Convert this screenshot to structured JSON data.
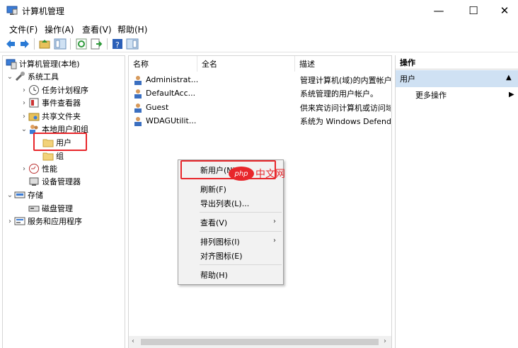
{
  "window": {
    "title": "计算机管理",
    "controls": {
      "minimize": "—",
      "maximize": "☐",
      "close": "✕"
    }
  },
  "menubar": [
    "文件(F)",
    "操作(A)",
    "查看(V)",
    "帮助(H)"
  ],
  "tree": [
    {
      "label": "计算机管理(本地)",
      "icon": "computer-management-icon",
      "expand": ""
    },
    {
      "label": "系统工具",
      "icon": "system-tools-icon",
      "expand": "⌄"
    },
    {
      "label": "任务计划程序",
      "icon": "task-scheduler-icon",
      "expand": "›"
    },
    {
      "label": "事件查看器",
      "icon": "event-viewer-icon",
      "expand": "›"
    },
    {
      "label": "共享文件夹",
      "icon": "shared-folders-icon",
      "expand": "›"
    },
    {
      "label": "本地用户和组",
      "icon": "local-users-groups-icon",
      "expand": "⌄"
    },
    {
      "label": "用户",
      "icon": "folder-icon",
      "expand": ""
    },
    {
      "label": "组",
      "icon": "folder-icon",
      "expand": ""
    },
    {
      "label": "性能",
      "icon": "performance-icon",
      "expand": "›"
    },
    {
      "label": "设备管理器",
      "icon": "device-manager-icon",
      "expand": ""
    },
    {
      "label": "存储",
      "icon": "storage-icon",
      "expand": "⌄"
    },
    {
      "label": "磁盘管理",
      "icon": "disk-management-icon",
      "expand": ""
    },
    {
      "label": "服务和应用程序",
      "icon": "services-apps-icon",
      "expand": "›"
    }
  ],
  "list": {
    "columns": [
      "名称",
      "全名",
      "描述"
    ],
    "rows": [
      {
        "name": "Administrat...",
        "desc": "管理计算机(域)的内置帐户"
      },
      {
        "name": "DefaultAcc...",
        "desc": "系统管理的用户帐户。"
      },
      {
        "name": "Guest",
        "desc": "供来宾访问计算机或访问域"
      },
      {
        "name": "WDAGUtilit...",
        "desc": "系统为 Windows Defend"
      }
    ]
  },
  "actions": {
    "header": "操作",
    "section": "用户",
    "more": "更多操作"
  },
  "context_menu": {
    "new_user": "新用户(N)...",
    "refresh": "刷新(F)",
    "export": "导出列表(L)...",
    "view": "查看(V)",
    "arrange": "排列图标(I)",
    "align": "对齐图标(E)",
    "help": "帮助(H)"
  },
  "watermark": {
    "logo": "php",
    "text": "中文网"
  },
  "colors": {
    "highlight": "#e8262b",
    "selection": "#cfe1f3"
  }
}
